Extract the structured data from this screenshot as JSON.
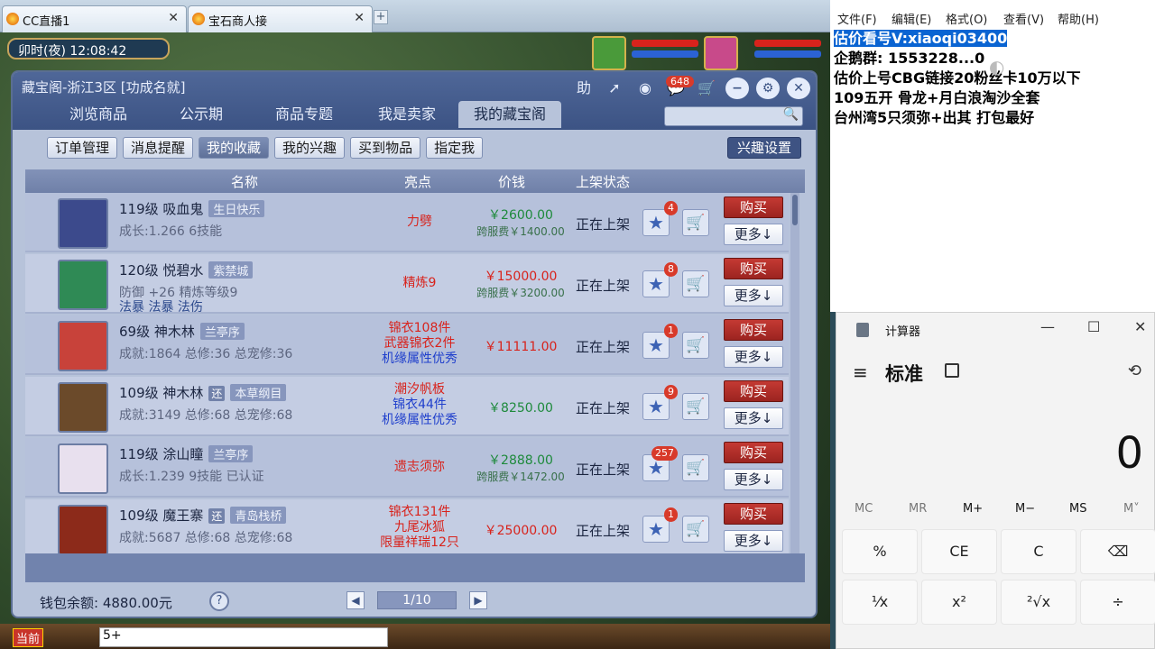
{
  "browser": {
    "tabs": [
      {
        "label": "CC直播1",
        "close": "✕"
      },
      {
        "label": "宝石商人接",
        "close": "✕"
      }
    ],
    "new_tab": "+"
  },
  "game": {
    "time_label": "卯时(夜)  12:08:42",
    "chat_channel": "当前",
    "chat_input_value": "5+"
  },
  "dialog": {
    "title": "藏宝阁-浙江3区 [功成名就]",
    "help_char": "助",
    "msg_count": "648",
    "tabs": [
      "浏览商品",
      "公示期",
      "商品专题",
      "我是卖家",
      "我的藏宝阁"
    ],
    "sub_buttons": [
      "订单管理",
      "消息提醒",
      "我的收藏",
      "我的兴趣",
      "买到物品",
      "指定我"
    ],
    "interest_settings": "兴趣设置",
    "columns": {
      "name": "名称",
      "highlight": "亮点",
      "price": "价钱",
      "status": "上架状态"
    },
    "rows": [
      {
        "level_name": "119级  吸血鬼",
        "server": "生日快乐",
        "huan": "",
        "line2": "成长:1.266  6技能",
        "line3": "",
        "highlights": [
          {
            "t": "力劈",
            "c": "#d8231c"
          }
        ],
        "price": "￥2600.00",
        "price_color": "#1e8a3c",
        "fee": "跨服费￥1400.00",
        "status": "正在上架",
        "fav": "4",
        "buy": "购买",
        "more": "更多↓"
      },
      {
        "level_name": "120级  悦碧水",
        "server": "紫禁城",
        "huan": "",
        "line2": "防御 +26 精炼等级9",
        "line3": "法暴  法暴  法伤",
        "highlights": [
          {
            "t": "精炼9",
            "c": "#d8231c"
          }
        ],
        "price": "￥15000.00",
        "price_color": "#d8231c",
        "fee": "跨服费￥3200.00",
        "status": "正在上架",
        "fav": "8",
        "buy": "购买",
        "more": "更多↓"
      },
      {
        "level_name": "69级  神木林",
        "server": "兰亭序",
        "huan": "",
        "line2": "成就:1864  总修:36  总宠修:36",
        "line3": "",
        "highlights": [
          {
            "t": "锦衣108件",
            "c": "#d8231c"
          },
          {
            "t": "武器锦衣2件",
            "c": "#d8231c"
          },
          {
            "t": "机缘属性优秀",
            "c": "#1f3fcc"
          }
        ],
        "price": "￥11111.00",
        "price_color": "#d8231c",
        "fee": "",
        "status": "正在上架",
        "fav": "1",
        "buy": "购买",
        "more": "更多↓"
      },
      {
        "level_name": "109级  神木林",
        "server": "本草纲目",
        "huan": "还",
        "line2": "成就:3149  总修:68  总宠修:68",
        "line3": "",
        "highlights": [
          {
            "t": "潮汐帆板",
            "c": "#d8231c"
          },
          {
            "t": "锦衣44件",
            "c": "#1f3fcc"
          },
          {
            "t": "机缘属性优秀",
            "c": "#1f3fcc"
          }
        ],
        "price": "￥8250.00",
        "price_color": "#1e8a3c",
        "fee": "",
        "status": "正在上架",
        "fav": "9",
        "buy": "购买",
        "more": "更多↓"
      },
      {
        "level_name": "119级  涂山瞳",
        "server": "兰亭序",
        "huan": "",
        "line2": "成长:1.239  9技能  已认证",
        "line3": "",
        "highlights": [
          {
            "t": "遗志须弥",
            "c": "#d8231c"
          }
        ],
        "price": "￥2888.00",
        "price_color": "#1e8a3c",
        "fee": "跨服费￥1472.00",
        "status": "正在上架",
        "fav": "257",
        "buy": "购买",
        "more": "更多↓"
      },
      {
        "level_name": "109级  魔王寨",
        "server": "青岛栈桥",
        "huan": "还",
        "line2": "成就:5687  总修:68  总宠修:68",
        "line3": "",
        "highlights": [
          {
            "t": "锦衣131件",
            "c": "#d8231c"
          },
          {
            "t": "九尾冰狐",
            "c": "#d8231c"
          },
          {
            "t": "限量祥瑞12只",
            "c": "#d8231c"
          }
        ],
        "price": "￥25000.00",
        "price_color": "#d8231c",
        "fee": "",
        "status": "正在上架",
        "fav": "1",
        "buy": "购买",
        "more": "更多↓"
      }
    ],
    "wallet": "钱包余额: 4880.00元",
    "help": "?",
    "page": "1/10"
  },
  "notepad": {
    "menu": [
      "文件(F)",
      "编辑(E)",
      "格式(O)",
      "查看(V)",
      "帮助(H)"
    ],
    "lines": [
      "估价看号V:xiaoqi03400",
      "企鹅群: 1553228...0",
      "估价上号CBG链接20粉丝卡10万以下",
      "109五开 骨龙+月白浪淘沙全套",
      "台州湾5只须弥+出其 打包最好"
    ]
  },
  "calculator": {
    "title": "计算器",
    "mode": "标准",
    "display": "0",
    "memory": [
      "MC",
      "MR",
      "M+",
      "M−",
      "MS",
      "M˅"
    ],
    "keys_row1": [
      "%",
      "CE",
      "C",
      "⌫"
    ],
    "keys_row2": [
      "¹⁄x",
      "x²",
      "²√x",
      "÷"
    ]
  },
  "colors": {
    "dialog_header": "#3c5384",
    "buy_button": "#b0302a",
    "price_red": "#d8231c",
    "price_green": "#1e8a3c"
  }
}
